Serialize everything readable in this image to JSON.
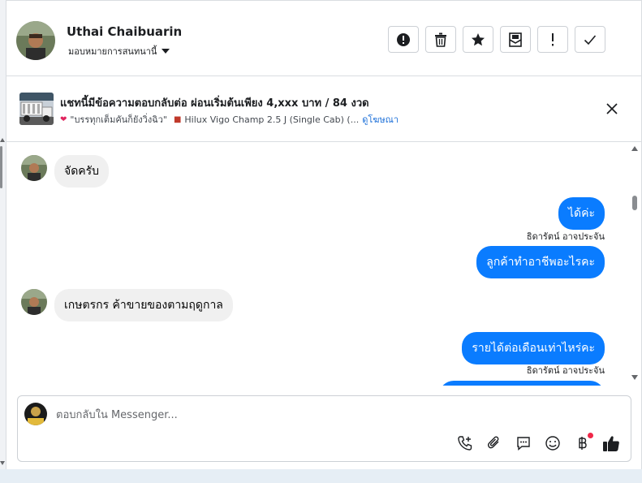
{
  "header": {
    "contact_name": "Uthai Chaibuarin",
    "assign_label": "มอบหมายการสนทนานี้",
    "actions": [
      {
        "icon": "alert-circle-icon"
      },
      {
        "icon": "trash-icon"
      },
      {
        "icon": "star-icon"
      },
      {
        "icon": "mark-unread-icon"
      },
      {
        "icon": "exclamation-icon"
      },
      {
        "icon": "check-icon"
      }
    ]
  },
  "ad_banner": {
    "title": "แชทนี้มีข้อความตอบกลับต่อ ผ่อนเริ่มต้นเพียง 4,xxx บาท / 84 งวด",
    "subtitle_quote": "\"บรรทุกเต็มคันก็ยังวิ่งฉิว\"",
    "subtitle_model": "Hilux Vigo Champ 2.5 J (Single Cab) (...",
    "see_ad_link": "ดูโฆษณา"
  },
  "messages": [
    {
      "direction": "in",
      "text": "จัดครับ"
    },
    {
      "direction": "out",
      "text": "ได้ค่ะ"
    },
    {
      "direction": "sender",
      "text": "ธิดารัตน์ อาจประจัน"
    },
    {
      "direction": "out",
      "text": "ลูกค้าทำอาชีพอะไรคะ"
    },
    {
      "direction": "in",
      "text": "เกษตรกร  ค้าขายของตามฤดูกาล"
    },
    {
      "direction": "out",
      "text": "รายได้ต่อเดือนเท่าไหร่คะ"
    },
    {
      "direction": "sender",
      "text": "ธิดารัตน์ อาจประจัน"
    }
  ],
  "composer": {
    "placeholder": "ตอบกลับใน Messenger...",
    "tools": [
      "phone-plus-icon",
      "paperclip-icon",
      "saved-reply-icon",
      "emoji-icon",
      "baht-icon",
      "thumbs-up-icon"
    ]
  },
  "colors": {
    "outgoing_bubble": "#0a7cff",
    "incoming_bubble": "#f0f0f0",
    "link": "#1a6ed8",
    "notification_dot": "#f02849"
  }
}
